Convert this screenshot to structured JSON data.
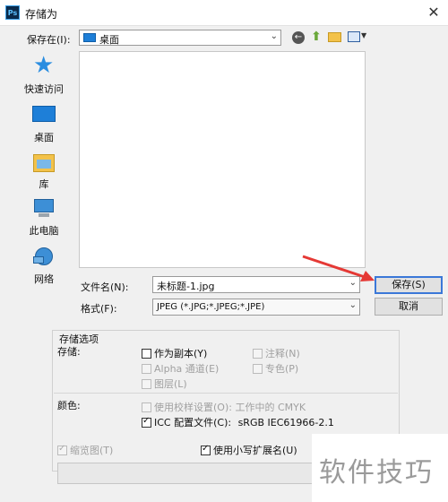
{
  "window": {
    "title": "存储为",
    "app_icon_text": "Ps"
  },
  "location": {
    "label": "保存在(I):",
    "value": "桌面"
  },
  "sidebar": {
    "items": [
      {
        "label": "快速访问",
        "icon": "star-icon"
      },
      {
        "label": "桌面",
        "icon": "desktop-icon"
      },
      {
        "label": "库",
        "icon": "library-icon"
      },
      {
        "label": "此电脑",
        "icon": "computer-icon"
      },
      {
        "label": "网络",
        "icon": "network-icon"
      }
    ]
  },
  "filename": {
    "label": "文件名(N):",
    "value": "未标题-1.jpg"
  },
  "format": {
    "label": "格式(F):",
    "value": "JPEG (*.JPG;*.JPEG;*.JPE)"
  },
  "buttons": {
    "save": "保存(S)",
    "cancel": "取消"
  },
  "options": {
    "group_title": "存储选项",
    "save_label": "存储:",
    "as_copy": "作为副本(Y)",
    "notes": "注释(N)",
    "alpha": "Alpha 通道(E)",
    "spot": "专色(P)",
    "layers": "图层(L)",
    "color_label": "颜色:",
    "use_proof": "使用校样设置(O): 工作中的 CMYK",
    "icc_label": "ICC 配置文件(C):",
    "icc_value": "sRGB IEC61966-2.1",
    "thumbnail": "缩览图(T)",
    "lowercase_ext": "使用小写扩展名(U)"
  },
  "watermark": "软件技巧",
  "colors": {
    "accent": "#3b78d8",
    "arrow": "#e53935",
    "folder_blue": "#1e7fd8"
  }
}
